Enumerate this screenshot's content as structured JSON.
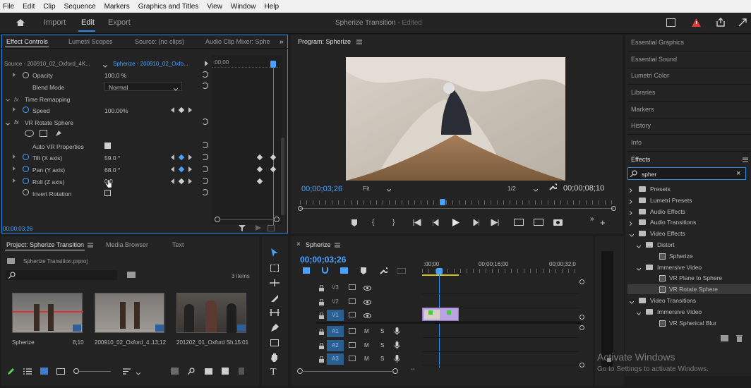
{
  "menu": [
    "File",
    "Edit",
    "Clip",
    "Sequence",
    "Markers",
    "Graphics and Titles",
    "View",
    "Window",
    "Help"
  ],
  "workspace": {
    "tabs": [
      "Import",
      "Edit",
      "Export"
    ],
    "active_tab": "Edit",
    "title": "Spherize Transition",
    "title_status": "- Edited"
  },
  "effect_controls": {
    "tabs": [
      "Effect Controls",
      "Lumetri Scopes",
      "Source: (no clips)",
      "Audio Clip Mixer: Sphe"
    ],
    "source_label": "Source - 200910_02_Oxford_4K...",
    "sequence_label": "Spherize - 200910_02_Oxfo...",
    "ruler_time": ":00;00",
    "rows": {
      "opacity_label": "Opacity",
      "opacity_value": "100.0 %",
      "blend_label": "Blend Mode",
      "blend_value": "Normal",
      "time_remap_label": "Time Remapping",
      "speed_label": "Speed",
      "speed_value": "100.00%",
      "vr_label": "VR Rotate Sphere",
      "auto_vr_label": "Auto VR Properties",
      "tilt_label": "Tilt (X axis)",
      "tilt_value": "59.0 °",
      "pan_label": "Pan (Y axis)",
      "pan_value": "68.0 °",
      "roll_label": "Roll (Z axis)",
      "roll_value": "0.0",
      "invert_label": "Invert Rotation"
    },
    "timecode": "00;00;03;26"
  },
  "program": {
    "title": "Program: Spherize",
    "timecode": "00;00;03;26",
    "fit": "Fit",
    "resolution": "1/2",
    "duration": "00;00;08;10"
  },
  "right_panel": {
    "items": [
      "Essential Graphics",
      "Essential Sound",
      "Lumetri Color",
      "Libraries",
      "Markers",
      "History",
      "Info"
    ],
    "effects_title": "Effects",
    "search_value": "spher",
    "tree": [
      {
        "label": "Presets",
        "level": 0,
        "type": "folder"
      },
      {
        "label": "Lumetri Presets",
        "level": 0,
        "type": "folder"
      },
      {
        "label": "Audio Effects",
        "level": 0,
        "type": "folder"
      },
      {
        "label": "Audio Transitions",
        "level": 0,
        "type": "folder"
      },
      {
        "label": "Video Effects",
        "level": 0,
        "type": "folder"
      },
      {
        "label": "Distort",
        "level": 1,
        "type": "folder"
      },
      {
        "label": "Spherize",
        "level": 2,
        "type": "effect"
      },
      {
        "label": "Immersive Video",
        "level": 1,
        "type": "folder"
      },
      {
        "label": "VR Plane to Sphere",
        "level": 2,
        "type": "effect"
      },
      {
        "label": "VR Rotate Sphere",
        "level": 2,
        "type": "effect",
        "selected": true
      },
      {
        "label": "Video Transitions",
        "level": 0,
        "type": "folder"
      },
      {
        "label": "Immersive Video",
        "level": 1,
        "type": "folder"
      },
      {
        "label": "VR Spherical Blur",
        "level": 2,
        "type": "effect"
      }
    ]
  },
  "project": {
    "tabs": [
      "Project: Spherize Transition",
      "Media Browser",
      "Text"
    ],
    "file": "Spherize Transition.prproj",
    "count": "3 items",
    "items": [
      {
        "name": "Spherize",
        "duration": "8;10"
      },
      {
        "name": "200910_02_Oxford_4...",
        "duration": "13;12"
      },
      {
        "name": "201202_01_Oxford Sh...",
        "duration": "15:01"
      }
    ]
  },
  "timeline": {
    "title": "Spherize",
    "timecode": "00;00;03;26",
    "ruler": [
      ":00;00",
      "00;00;16;00",
      "00;00;32;0"
    ],
    "video_tracks": [
      "V3",
      "V2",
      "V1"
    ],
    "audio_tracks": [
      "A1",
      "A2",
      "A3"
    ],
    "m_label": "M",
    "s_label": "S"
  },
  "watermark": {
    "line1": "Activate Windows",
    "line2": "Go to Settings to activate Windows."
  },
  "colors": {
    "accent": "#2d8ceb",
    "keyframe_blue": "#4aa2ff",
    "clip_purple": "#b9a3e3",
    "track_blue": "#2a5f8f"
  }
}
